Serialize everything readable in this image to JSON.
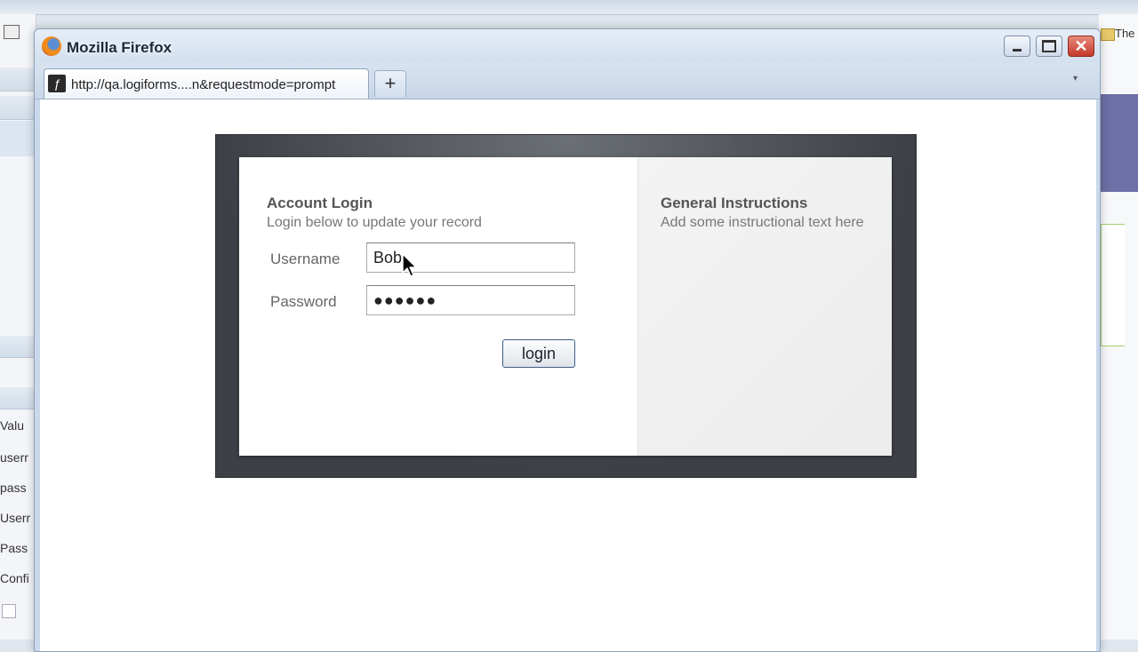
{
  "background": {
    "left_rows": [
      "Valu",
      "userr",
      "pass",
      "Userr",
      "Pass",
      "Confi"
    ],
    "right_label": "The"
  },
  "browser": {
    "window_title": "Mozilla Firefox",
    "tab_url": "http://qa.logiforms....n&requestmode=prompt",
    "new_tab_glyph": "+",
    "close_glyph": "✕"
  },
  "login": {
    "heading": "Account Login",
    "subtext": "Login below to update your record",
    "username_label": "Username",
    "username_value": "Bob",
    "password_label": "Password",
    "password_value": "●●●●●●",
    "button_label": "login"
  },
  "instructions": {
    "heading": "General Instructions",
    "text": "Add some instructional text here"
  },
  "icons": {
    "browser_logo": "firefox-logo-icon",
    "cursor": "mouse-pointer-icon"
  }
}
